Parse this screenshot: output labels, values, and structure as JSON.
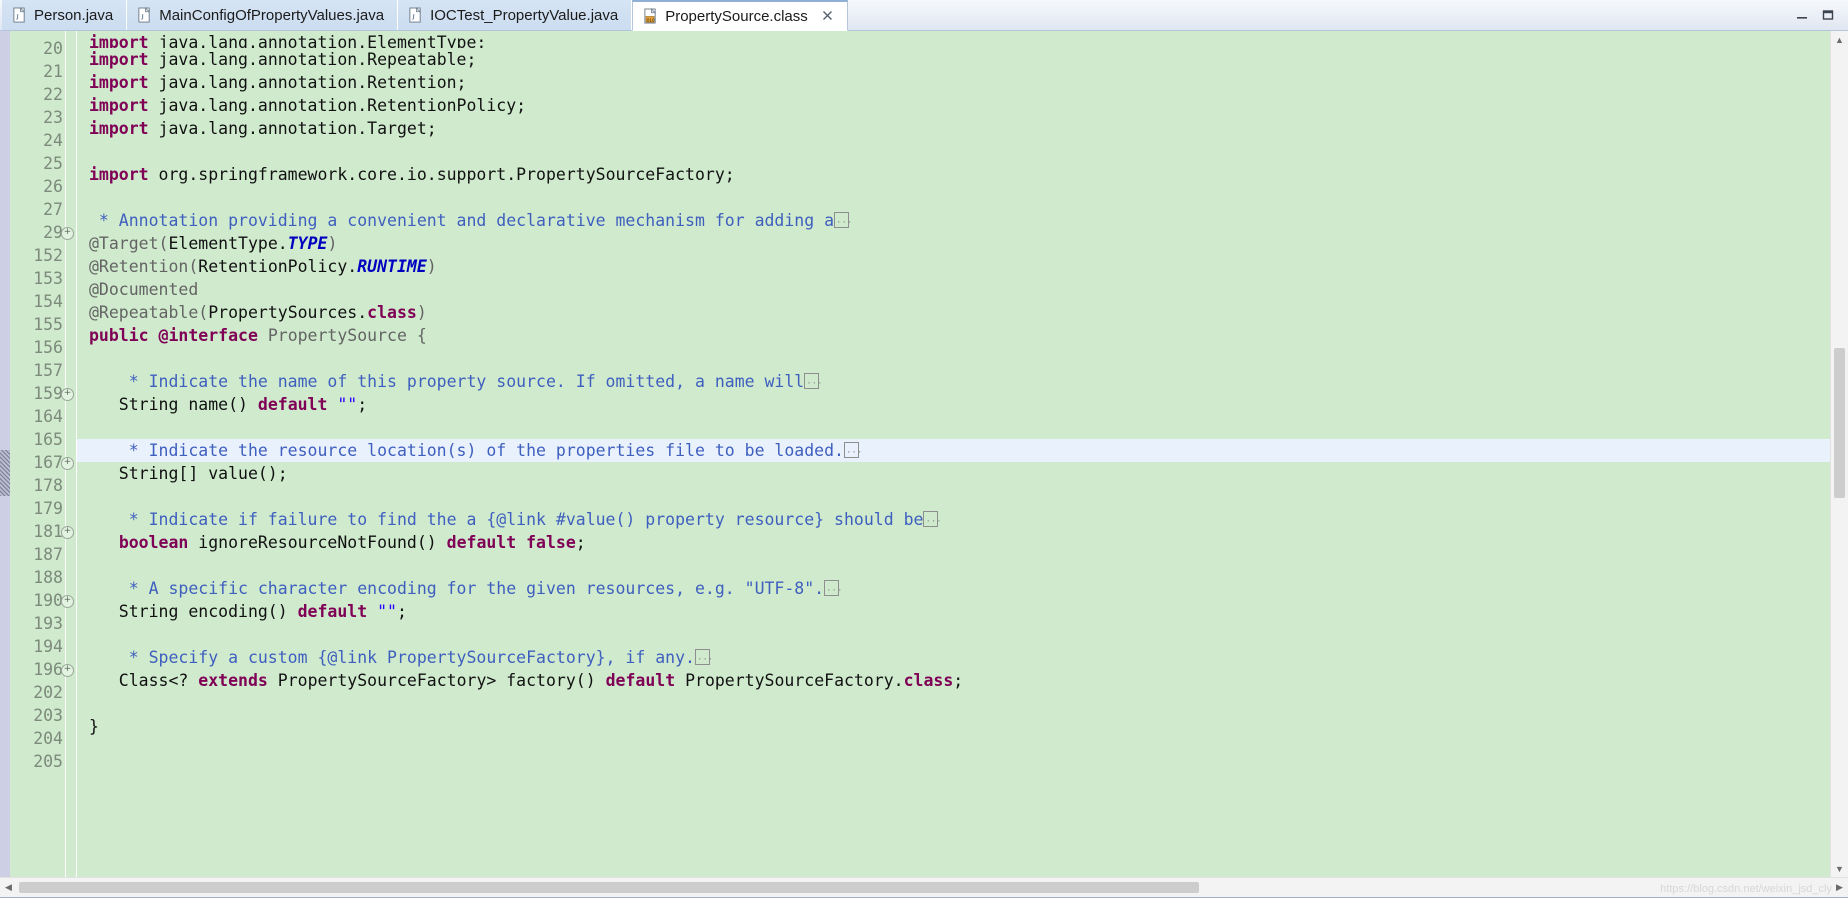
{
  "window": {
    "minimize_label": "–",
    "maximize_label": "❐"
  },
  "tabbar": {
    "tabs": [
      {
        "label": "Person.java",
        "icon": "java-file-icon",
        "active": false,
        "closable": false
      },
      {
        "label": "MainConfigOfPropertyValues.java",
        "icon": "java-file-icon",
        "active": false,
        "closable": false
      },
      {
        "label": "IOCTest_PropertyValue.java",
        "icon": "java-file-icon",
        "active": false,
        "closable": false
      },
      {
        "label": "PropertySource.class",
        "icon": "class-file-icon",
        "active": true,
        "closable": true
      }
    ],
    "close_glyph": "✖"
  },
  "editor": {
    "highlighted_line": "167",
    "fold_glyph": "⊕",
    "fold_box_glyph": "⋯",
    "lines": [
      {
        "num": "20",
        "clipped": true,
        "fold": false,
        "highlight": false,
        "tokens": [
          {
            "t": "kw",
            "v": "import"
          },
          {
            "t": "plain",
            "v": " java.lang.annotation.ElementType;"
          }
        ]
      },
      {
        "num": "21",
        "clipped": false,
        "fold": false,
        "highlight": false,
        "tokens": [
          {
            "t": "kw",
            "v": "import"
          },
          {
            "t": "plain",
            "v": " java.lang.annotation.Repeatable;"
          }
        ]
      },
      {
        "num": "22",
        "clipped": false,
        "fold": false,
        "highlight": false,
        "tokens": [
          {
            "t": "kw",
            "v": "import"
          },
          {
            "t": "plain",
            "v": " java.lang.annotation.Retention;"
          }
        ]
      },
      {
        "num": "23",
        "clipped": false,
        "fold": false,
        "highlight": false,
        "tokens": [
          {
            "t": "kw",
            "v": "import"
          },
          {
            "t": "plain",
            "v": " java.lang.annotation.RetentionPolicy;"
          }
        ]
      },
      {
        "num": "24",
        "clipped": false,
        "fold": false,
        "highlight": false,
        "tokens": [
          {
            "t": "kw",
            "v": "import"
          },
          {
            "t": "plain",
            "v": " java.lang.annotation.Target;"
          }
        ]
      },
      {
        "num": "25",
        "clipped": false,
        "fold": false,
        "highlight": false,
        "tokens": []
      },
      {
        "num": "26",
        "clipped": false,
        "fold": false,
        "highlight": false,
        "tokens": [
          {
            "t": "kw",
            "v": "import"
          },
          {
            "t": "plain",
            "v": " org.springframework.core.io.support.PropertySourceFactory;"
          }
        ]
      },
      {
        "num": "27",
        "clipped": false,
        "fold": false,
        "highlight": false,
        "tokens": []
      },
      {
        "num": "29",
        "clipped": false,
        "fold": true,
        "highlight": false,
        "tokens": [
          {
            "t": "cmt",
            "v": " * Annotation providing a convenient and declarative mechanism for adding a"
          },
          {
            "t": "foldbox",
            "v": ""
          }
        ]
      },
      {
        "num": "152",
        "clipped": false,
        "fold": false,
        "highlight": false,
        "tokens": [
          {
            "t": "ann",
            "v": "@Target("
          },
          {
            "t": "plain",
            "v": "ElementType."
          },
          {
            "t": "italicf",
            "v": "TYPE"
          },
          {
            "t": "ann",
            "v": ")"
          }
        ]
      },
      {
        "num": "153",
        "clipped": false,
        "fold": false,
        "highlight": false,
        "tokens": [
          {
            "t": "ann",
            "v": "@Retention("
          },
          {
            "t": "plain",
            "v": "RetentionPolicy."
          },
          {
            "t": "italicf",
            "v": "RUNTIME"
          },
          {
            "t": "ann",
            "v": ")"
          }
        ]
      },
      {
        "num": "154",
        "clipped": false,
        "fold": false,
        "highlight": false,
        "tokens": [
          {
            "t": "ann",
            "v": "@Documented"
          }
        ]
      },
      {
        "num": "155",
        "clipped": false,
        "fold": false,
        "highlight": false,
        "tokens": [
          {
            "t": "ann",
            "v": "@Repeatable("
          },
          {
            "t": "plain",
            "v": "PropertySources."
          },
          {
            "t": "kw",
            "v": "class"
          },
          {
            "t": "ann",
            "v": ")"
          }
        ]
      },
      {
        "num": "156",
        "clipped": false,
        "fold": false,
        "highlight": false,
        "tokens": [
          {
            "t": "kw",
            "v": "public @interface"
          },
          {
            "t": "ann",
            "v": " PropertySource {"
          }
        ]
      },
      {
        "num": "157",
        "clipped": false,
        "fold": false,
        "highlight": false,
        "tokens": []
      },
      {
        "num": "159",
        "clipped": false,
        "fold": true,
        "highlight": false,
        "tokens": [
          {
            "t": "cmt",
            "v": "    * Indicate the name of this property source. If omitted, a name will"
          },
          {
            "t": "foldbox",
            "v": ""
          }
        ]
      },
      {
        "num": "164",
        "clipped": false,
        "fold": false,
        "highlight": false,
        "tokens": [
          {
            "t": "plain",
            "v": "   String name() "
          },
          {
            "t": "kw",
            "v": "default"
          },
          {
            "t": "plain",
            "v": " "
          },
          {
            "t": "str",
            "v": "\"\""
          },
          {
            "t": "plain",
            "v": ";"
          }
        ]
      },
      {
        "num": "165",
        "clipped": false,
        "fold": false,
        "highlight": false,
        "tokens": []
      },
      {
        "num": "167",
        "clipped": false,
        "fold": true,
        "highlight": true,
        "tokens": [
          {
            "t": "cmt",
            "v": "    * Indicate the resource location(s) of the properties file to be loaded."
          },
          {
            "t": "foldbox",
            "v": ""
          }
        ]
      },
      {
        "num": "178",
        "clipped": false,
        "fold": false,
        "highlight": false,
        "tokens": [
          {
            "t": "plain",
            "v": "   String[] value();"
          }
        ]
      },
      {
        "num": "179",
        "clipped": false,
        "fold": false,
        "highlight": false,
        "tokens": []
      },
      {
        "num": "181",
        "clipped": false,
        "fold": true,
        "highlight": false,
        "tokens": [
          {
            "t": "cmt",
            "v": "    * Indicate if failure to find the a {@link #value() property resource} should be"
          },
          {
            "t": "foldbox",
            "v": ""
          }
        ]
      },
      {
        "num": "187",
        "clipped": false,
        "fold": false,
        "highlight": false,
        "tokens": [
          {
            "t": "plain",
            "v": "   "
          },
          {
            "t": "kw",
            "v": "boolean"
          },
          {
            "t": "plain",
            "v": " ignoreResourceNotFound() "
          },
          {
            "t": "kw",
            "v": "default"
          },
          {
            "t": "plain",
            "v": " "
          },
          {
            "t": "kw",
            "v": "false"
          },
          {
            "t": "plain",
            "v": ";"
          }
        ]
      },
      {
        "num": "188",
        "clipped": false,
        "fold": false,
        "highlight": false,
        "tokens": []
      },
      {
        "num": "190",
        "clipped": false,
        "fold": true,
        "highlight": false,
        "tokens": [
          {
            "t": "cmt",
            "v": "    * A specific character encoding for the given resources, e.g. \"UTF-8\"."
          },
          {
            "t": "foldbox",
            "v": ""
          }
        ]
      },
      {
        "num": "193",
        "clipped": false,
        "fold": false,
        "highlight": false,
        "tokens": [
          {
            "t": "plain",
            "v": "   String encoding() "
          },
          {
            "t": "kw",
            "v": "default"
          },
          {
            "t": "plain",
            "v": " "
          },
          {
            "t": "str",
            "v": "\"\""
          },
          {
            "t": "plain",
            "v": ";"
          }
        ]
      },
      {
        "num": "194",
        "clipped": false,
        "fold": false,
        "highlight": false,
        "tokens": []
      },
      {
        "num": "196",
        "clipped": false,
        "fold": true,
        "highlight": false,
        "tokens": [
          {
            "t": "cmt",
            "v": "    * Specify a custom {@link PropertySourceFactory}, if any."
          },
          {
            "t": "foldbox",
            "v": ""
          }
        ]
      },
      {
        "num": "202",
        "clipped": false,
        "fold": false,
        "highlight": false,
        "tokens": [
          {
            "t": "plain",
            "v": "   Class<? "
          },
          {
            "t": "kw",
            "v": "extends"
          },
          {
            "t": "plain",
            "v": " PropertySourceFactory> factory() "
          },
          {
            "t": "kw",
            "v": "default"
          },
          {
            "t": "plain",
            "v": " PropertySourceFactory."
          },
          {
            "t": "kw",
            "v": "class"
          },
          {
            "t": "plain",
            "v": ";"
          }
        ]
      },
      {
        "num": "203",
        "clipped": false,
        "fold": false,
        "highlight": false,
        "tokens": []
      },
      {
        "num": "204",
        "clipped": false,
        "fold": false,
        "highlight": false,
        "tokens": [
          {
            "t": "plain",
            "v": "}"
          }
        ]
      },
      {
        "num": "205",
        "clipped": false,
        "fold": false,
        "highlight": false,
        "tokens": []
      }
    ]
  },
  "scrollbars": {
    "vertical": {
      "up_glyph": "▲",
      "down_glyph": "▼"
    },
    "horizontal": {
      "left_glyph": "◀",
      "right_glyph": "▶"
    }
  },
  "watermark": {
    "text": "https://blog.csdn.net/weixin_jsd_cly"
  },
  "colors": {
    "code_background": "#cfeacd",
    "gutter_background": "#cfeacd",
    "highlight_line": "#e9f1fc",
    "keyword": "#7f0055",
    "comment": "#3f5fbf",
    "annotation": "#646464",
    "constant_italic": "#0000c0",
    "string": "#2a00ff",
    "tab_active": "#ffffff",
    "tab_inactive": "#cfe0f2"
  }
}
